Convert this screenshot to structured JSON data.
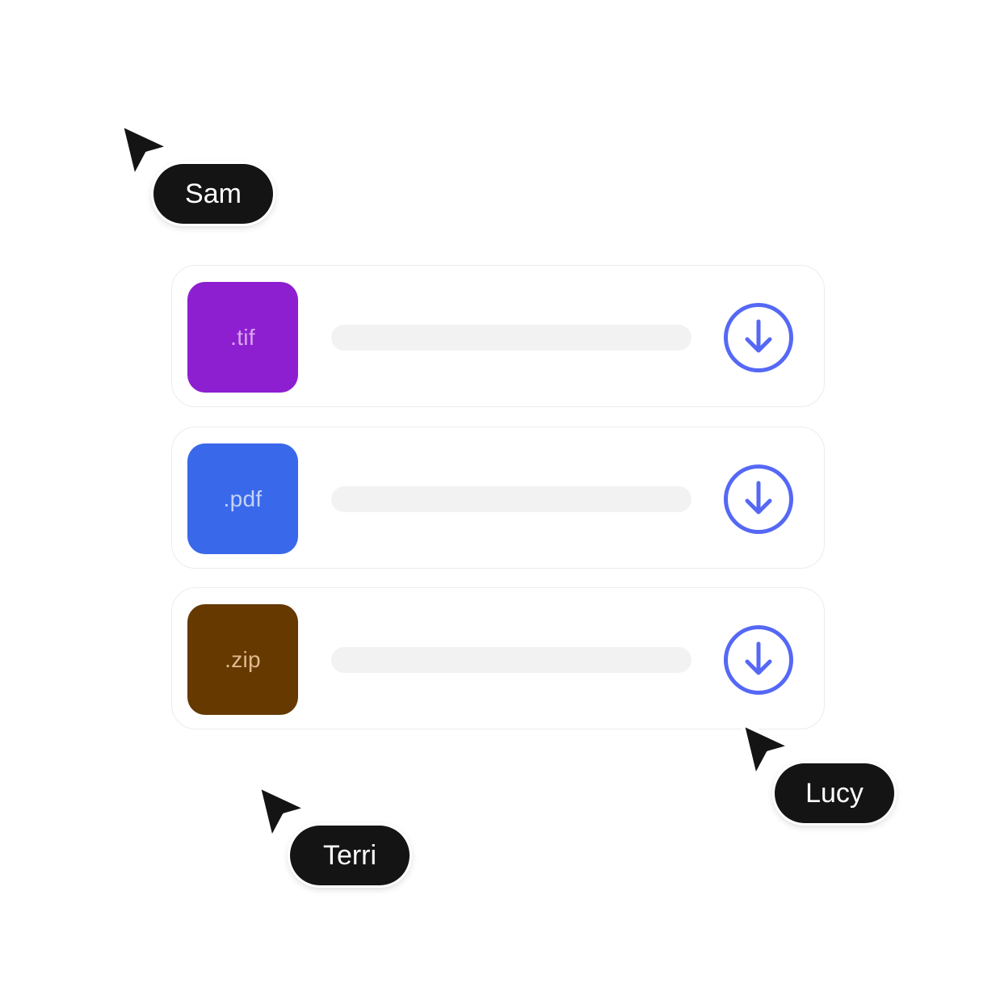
{
  "files": [
    {
      "extension": ".tif",
      "thumb_color": "#8e1fd1",
      "ext_color": "#d9a6ee",
      "download_icon": "arrow-down-circle-icon"
    },
    {
      "extension": ".pdf",
      "thumb_color": "#3968ea",
      "ext_color": "#c3d3f8",
      "download_icon": "arrow-down-circle-icon"
    },
    {
      "extension": ".zip",
      "thumb_color": "#663901",
      "ext_color": "#e0b98d",
      "download_icon": "arrow-down-circle-icon"
    }
  ],
  "cursors": [
    {
      "name": "Sam",
      "icon": "cursor-arrow-icon"
    },
    {
      "name": "Terri",
      "icon": "cursor-arrow-icon"
    },
    {
      "name": "Lucy",
      "icon": "cursor-arrow-icon"
    }
  ],
  "colors": {
    "accent": "#5568f5",
    "card_border": "#ececec",
    "placeholder": "#f2f2f2",
    "label_bg": "#141414",
    "label_text": "#ffffff"
  }
}
